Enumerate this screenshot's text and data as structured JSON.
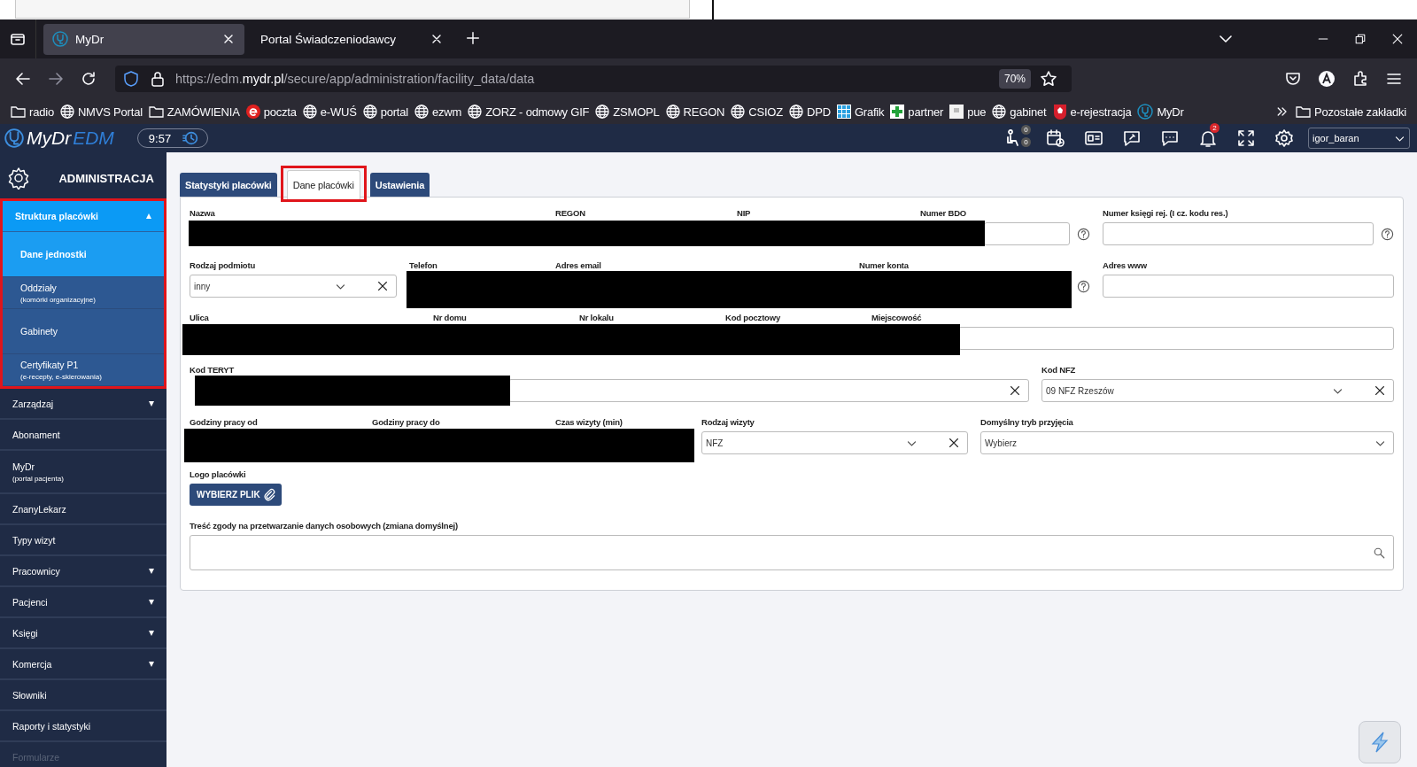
{
  "browser": {
    "tabs": [
      {
        "label": "MyDr",
        "selected": true
      },
      {
        "label": "Portal Świadczeniodawcy",
        "selected": false
      }
    ],
    "url": "https://edm.**mydr.pl**/secure/app/administration/facility_data/data",
    "zoom": "70%",
    "bookmarks": [
      {
        "label": "radio",
        "kind": "folder"
      },
      {
        "label": "NMVS Portal",
        "kind": "globe"
      },
      {
        "label": "ZAMÓWIENIA",
        "kind": "folder"
      },
      {
        "label": "poczta",
        "kind": "mail"
      },
      {
        "label": "e-WUŚ",
        "kind": "globe"
      },
      {
        "label": "portal",
        "kind": "globe"
      },
      {
        "label": "ezwm",
        "kind": "globe"
      },
      {
        "label": "ZORZ - odmowy GIF",
        "kind": "globe"
      },
      {
        "label": "ZSMOPL",
        "kind": "globe"
      },
      {
        "label": "REGON",
        "kind": "globe"
      },
      {
        "label": "CSIOZ",
        "kind": "globe"
      },
      {
        "label": "DPD",
        "kind": "globe"
      },
      {
        "label": "Grafik",
        "kind": "grid"
      },
      {
        "label": "partner",
        "kind": "cross"
      },
      {
        "label": "pue",
        "kind": "page"
      },
      {
        "label": "gabinet",
        "kind": "globe"
      },
      {
        "label": "e-rejestracja",
        "kind": "eagle"
      },
      {
        "label": "MyDr",
        "kind": "mydr"
      }
    ],
    "other_bookmarks": "Pozostałe zakładki"
  },
  "app": {
    "logo_name": "MyDr",
    "logo_suffix": "EDM",
    "clock": "9:57",
    "patients_badges": [
      "0",
      "0"
    ],
    "notifications_badge": "2",
    "user": "igor_baran"
  },
  "sidebar": {
    "title": "ADMINISTRACJA",
    "items": [
      {
        "label": "Struktura placówki",
        "expanded": true,
        "annotated": true,
        "children": [
          {
            "label": "Dane jednostki",
            "selected": true
          },
          {
            "label": "Oddziały",
            "sublabel": "(komórki organizacyjne)",
            "selected": false
          },
          {
            "label": "Gabinety",
            "selected": false
          },
          {
            "label": "Certyfikaty P1",
            "sublabel": "(e-recepty, e-skierowania)",
            "selected": false
          }
        ]
      },
      {
        "label": "Zarządzaj",
        "expanded": false
      },
      {
        "label": "Abonament"
      },
      {
        "label": "MyDr",
        "sublabel": "(portal pacjenta)"
      },
      {
        "label": "ZnanyLekarz"
      },
      {
        "label": "Typy wizyt"
      },
      {
        "label": "Pracownicy",
        "expanded": false
      },
      {
        "label": "Pacjenci",
        "expanded": false
      },
      {
        "label": "Księgi",
        "expanded": false
      },
      {
        "label": "Komercja",
        "expanded": false
      },
      {
        "label": "Słowniki"
      },
      {
        "label": "Raporty i statystyki"
      },
      {
        "label": "Formularze"
      }
    ]
  },
  "form": {
    "tabs": [
      {
        "label": "Statystyki placówki",
        "selected": false,
        "annotated": false
      },
      {
        "label": "Dane placówki",
        "selected": true,
        "annotated": true
      },
      {
        "label": "Ustawienia",
        "selected": false,
        "annotated": false
      }
    ],
    "lines": [
      [
        {
          "label": "Nazwa",
          "kind": "redacted"
        },
        {
          "label": "REGON",
          "kind": "redacted"
        },
        {
          "label": "NIP",
          "kind": "redacted"
        },
        {
          "label": "Numer BDO",
          "kind": "text",
          "help": true
        },
        {
          "label": "Numer księgi rej. (I cz. kodu res.)",
          "kind": "text",
          "help": true
        }
      ],
      [
        {
          "label": "Rodzaj podmiotu",
          "kind": "select",
          "value": "inny",
          "clearable": true
        },
        {
          "label": "Telefon",
          "kind": "redacted"
        },
        {
          "label": "Adres email",
          "kind": "redacted"
        },
        {
          "label": "Numer konta",
          "kind": "redacted",
          "help": true
        },
        {
          "label": "Adres www",
          "kind": "text"
        }
      ],
      [
        {
          "label": "Ulica",
          "kind": "redacted"
        },
        {
          "label": "Nr domu",
          "kind": "redacted"
        },
        {
          "label": "Nr lokalu",
          "kind": "redacted"
        },
        {
          "label": "Kod pocztowy",
          "kind": "redacted"
        },
        {
          "label": "Miejscowość",
          "kind": "text"
        }
      ],
      [
        {
          "label": "Kod TERYT",
          "kind": "text",
          "clearable": true
        },
        {
          "label": "Kod NFZ",
          "kind": "select",
          "value": "09 NFZ Rzeszów",
          "clearable": true
        }
      ],
      [
        {
          "label": "Godziny pracy od",
          "kind": "redacted"
        },
        {
          "label": "Godziny pracy do",
          "kind": "redacted"
        },
        {
          "label": "Czas wizyty (min)",
          "kind": "redacted"
        },
        {
          "label": "Rodzaj wizyty",
          "kind": "select",
          "value": "NFZ",
          "clearable": true
        },
        {
          "label": "Domyślny tryb przyjęcia",
          "kind": "select",
          "value": "Wybierz",
          "clearable": false
        }
      ],
      [
        {
          "label": "Logo placówki",
          "kind": "file",
          "button": "WYBIERZ PLIK"
        }
      ],
      [
        {
          "label": "Treść zgody na przetwarzanie danych osobowych (zmiana domyślnej)",
          "kind": "search"
        }
      ]
    ]
  }
}
